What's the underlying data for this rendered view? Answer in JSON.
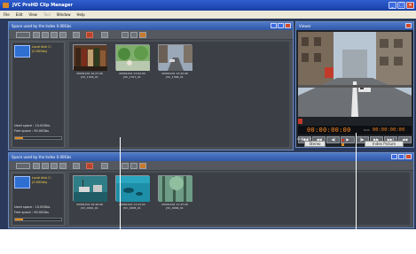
{
  "window": {
    "title": "JVC ProHD Clip Manager",
    "controls": [
      "_",
      "□",
      "×"
    ]
  },
  "menu": [
    "File",
    "Edit",
    "View",
    "Tool",
    "Window",
    "Help"
  ],
  "menu_disabled_index": 3,
  "top_pane": {
    "title": "Space used by the Index 0.00Gbs",
    "drive": {
      "name": "Local disk C:",
      "sub": "(0.00Gbs)"
    },
    "used_space": "Used space : 10.00Gbs",
    "free_space": "Free space : 90.00Gbs",
    "used_fraction": 0.18,
    "clips": [
      {
        "label": "20091201 10:27:26\nJVC_1316_01"
      },
      {
        "label": "20091201 13:02:00\nJVC_1317_01"
      },
      {
        "label": "20091201 13:42:26\nJVC_1306_01"
      }
    ]
  },
  "bottom_pane": {
    "title": "Space used by the Index 0.00Gbs",
    "drive": {
      "name": "Local disk C:",
      "sub": "(0.00Gbs)"
    },
    "used_space": "Used space : 10.00Gbs",
    "free_space": "Free space : 90.00Gbs",
    "used_fraction": 0.18,
    "clips": [
      {
        "label": "20091201 10:40:46\nJVC_0001_01"
      },
      {
        "label": "20091201 11:21:22\nJVC_0005_01"
      },
      {
        "label": "20091201 11:37:20\nJVC_0006_01"
      }
    ]
  },
  "viewer": {
    "title": "Viewer",
    "timecode": "00:00:00:00",
    "duration_label": "DUR",
    "duration": "00:00:00:00",
    "transport": [
      "|◀◀",
      "◀◀",
      "◀|",
      "▶",
      "|▶",
      "▶▶",
      "▶▶|",
      "◀◀"
    ],
    "audio_label": "Audio CH",
    "stereo_label": "Stereo",
    "audio_btn2": "Index Picture"
  },
  "colors": {
    "accent": "#2f57a8",
    "timecode": "#ff8a22",
    "drive_highlight": "#2e6fd1"
  }
}
